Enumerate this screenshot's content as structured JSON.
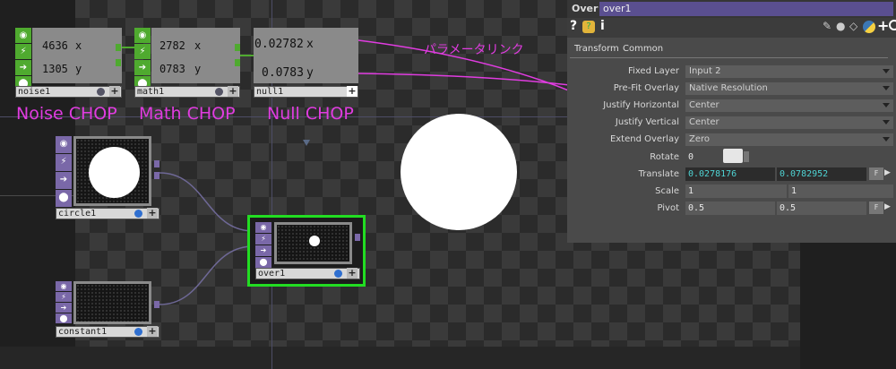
{
  "nodes": {
    "noise": {
      "name": "noise1",
      "x_value": "4636",
      "y_value": "1305",
      "x_label": "x",
      "y_label": "y",
      "caption": "Noise CHOP"
    },
    "math": {
      "name": "math1",
      "x_value": "2782",
      "y_value": "0783",
      "x_label": "x",
      "y_label": "y",
      "caption": "Math CHOP"
    },
    "null": {
      "name": "null1",
      "x_value": "0.02782",
      "y_value": "0.0783",
      "x_label": "x",
      "y_label": "y",
      "caption": "Null CHOP"
    },
    "circle": {
      "name": "circle1"
    },
    "over": {
      "name": "over1"
    },
    "constant": {
      "name": "constant1"
    }
  },
  "annotation": "パラメータリンク",
  "panel": {
    "op_type": "Over",
    "op_name": "over1",
    "tabs": [
      "Transform",
      "Common"
    ],
    "params": [
      {
        "label": "Fixed Layer",
        "value": "Input 2"
      },
      {
        "label": "Pre-Fit Overlay",
        "value": "Native Resolution"
      },
      {
        "label": "Justify Horizontal",
        "value": "Center"
      },
      {
        "label": "Justify Vertical",
        "value": "Center"
      },
      {
        "label": "Extend Overlay",
        "value": "Zero"
      }
    ],
    "rotate": {
      "label": "Rotate",
      "value": "0"
    },
    "translate": {
      "label": "Translate",
      "x": "0.0278176",
      "y": "0.0782952"
    },
    "scale": {
      "label": "Scale",
      "x": "1",
      "y": "1"
    },
    "pivot": {
      "label": "Pivot",
      "x": "0.5",
      "y": "0.5"
    },
    "f_button": "F"
  },
  "colors": {
    "accent": "#e03ce0",
    "chop": "#4faa2f",
    "top": "#7a68a8",
    "selected": "#22dd22"
  }
}
